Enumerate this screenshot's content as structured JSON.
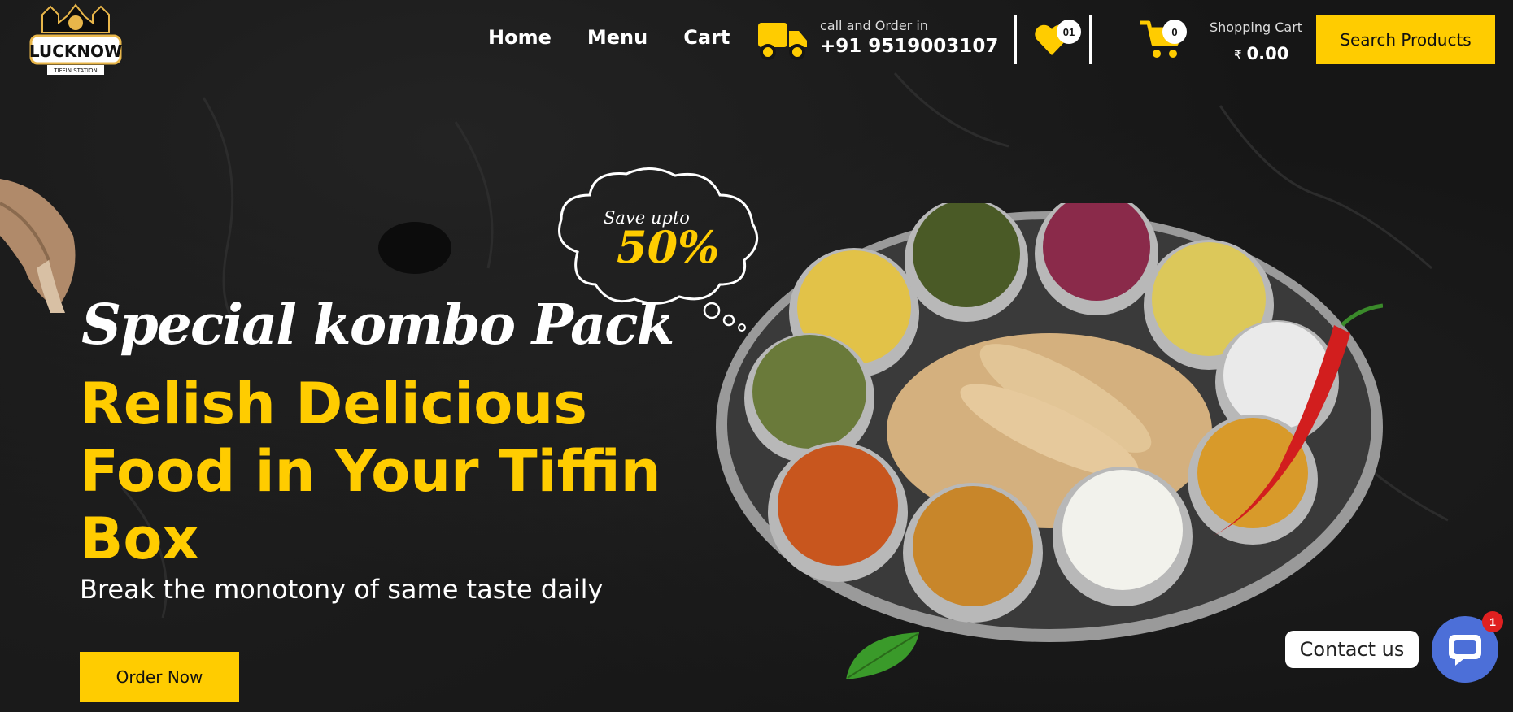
{
  "brand": {
    "logo_text": "LUCKNOW",
    "logo_subtext": "TIFFIN STATION"
  },
  "nav": {
    "items": [
      "Home",
      "Menu",
      "Cart"
    ]
  },
  "call": {
    "label": "call and Order in",
    "phone": "+91 9519003107"
  },
  "wishlist": {
    "count": "01"
  },
  "cart": {
    "count": "0",
    "label": "Shopping Cart",
    "currency": "₹",
    "total": "0.00"
  },
  "search": {
    "label": "Search Products"
  },
  "hero": {
    "promo_small": "Save upto",
    "promo_big": "50%",
    "script_title": "Special kombo Pack",
    "headline": "Relish Delicious Food in Your Tiffin Box",
    "subtext": "Break the monotony of same taste daily",
    "cta": "Order Now"
  },
  "contact": {
    "label": "Contact us",
    "badge": "1"
  },
  "colors": {
    "accent": "#ffcc00",
    "background": "#161616",
    "contact": "#4c6fd8",
    "alert": "#e02020"
  },
  "icons": [
    "truck-icon",
    "heart-icon",
    "cart-icon",
    "chat-icon"
  ]
}
